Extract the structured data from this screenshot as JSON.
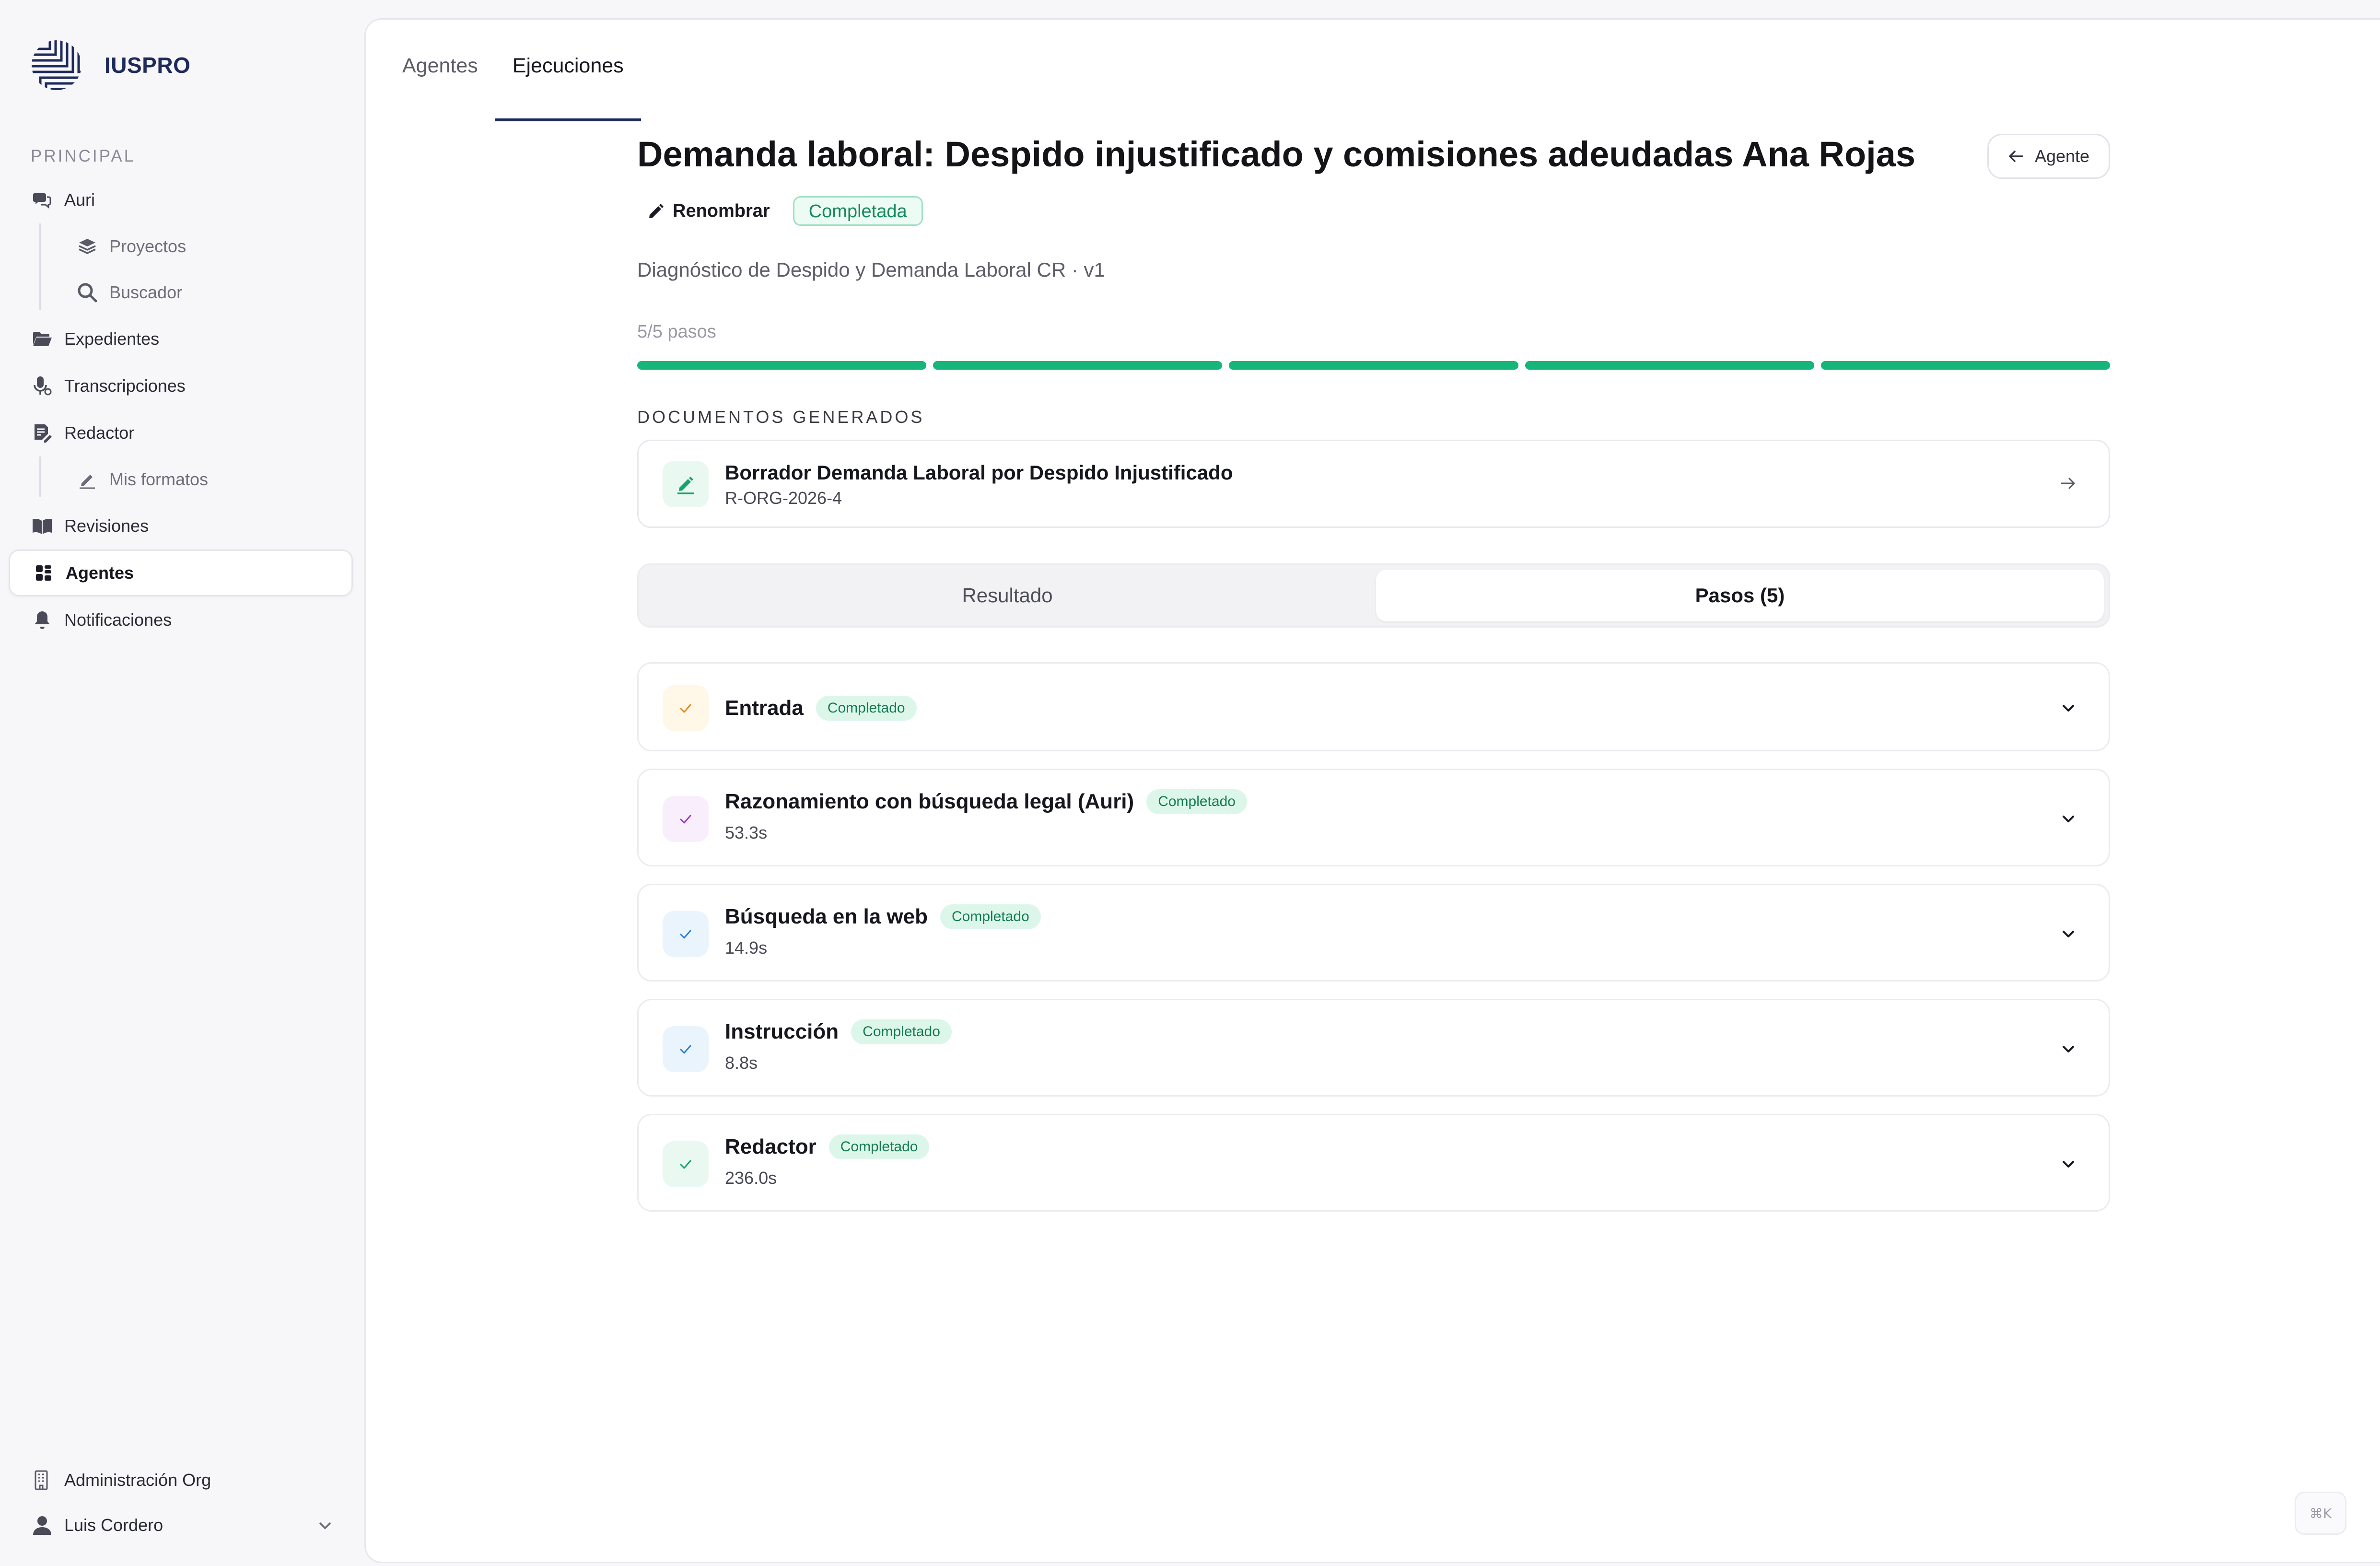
{
  "brand": {
    "name": "IUSPRO"
  },
  "sidebar": {
    "section_label": "PRINCIPAL",
    "items": [
      {
        "label": "Auri"
      },
      {
        "label": "Proyectos"
      },
      {
        "label": "Buscador"
      },
      {
        "label": "Expedientes"
      },
      {
        "label": "Transcripciones"
      },
      {
        "label": "Redactor"
      },
      {
        "label": "Mis formatos"
      },
      {
        "label": "Revisiones"
      },
      {
        "label": "Agentes"
      },
      {
        "label": "Notificaciones"
      }
    ],
    "active_item": "Agentes",
    "admin_label": "Administración Org",
    "user_name": "Luis Cordero"
  },
  "tabs": [
    {
      "label": "Agentes"
    },
    {
      "label": "Ejecuciones"
    }
  ],
  "active_tab": "Ejecuciones",
  "run": {
    "title": "Demanda laboral: Despido injustificado y comisiones adeudadas Ana Rojas",
    "back_button": "Agente",
    "rename_label": "Renombrar",
    "status": "Completada",
    "subtitle": "Diagnóstico de Despido y Demanda Laboral CR · v1",
    "steps_count": "5/5 pasos",
    "progress_completed": 5,
    "progress_total": 5,
    "progress_color": "#16b57a"
  },
  "documents": {
    "label": "DOCUMENTOS GENERADOS",
    "items": [
      {
        "title": "Borrador Demanda Laboral por Despido Injustificado",
        "code": "R-ORG-2026-4"
      }
    ]
  },
  "view_switch": {
    "options": [
      "Resultado",
      "Pasos (5)"
    ],
    "selected": "Pasos (5)"
  },
  "steps": [
    {
      "name": "Entrada",
      "status": "Completado",
      "time": "",
      "check_color": "#e08a1e",
      "check_bg": "#fff8e8"
    },
    {
      "name": "Razonamiento con búsqueda legal (Auri)",
      "status": "Completado",
      "time": "53.3s",
      "check_color": "#9a3cc8",
      "check_bg": "#f8eefc"
    },
    {
      "name": "Búsqueda en la web",
      "status": "Completado",
      "time": "14.9s",
      "check_color": "#2a7fd6",
      "check_bg": "#eaf4fd"
    },
    {
      "name": "Instrucción",
      "status": "Completado",
      "time": "8.8s",
      "check_color": "#2a7fd6",
      "check_bg": "#eaf4fd"
    },
    {
      "name": "Redactor",
      "status": "Completado",
      "time": "236.0s",
      "check_color": "#16a36a",
      "check_bg": "#e9f8f0"
    }
  ],
  "shortcut": "⌘K"
}
